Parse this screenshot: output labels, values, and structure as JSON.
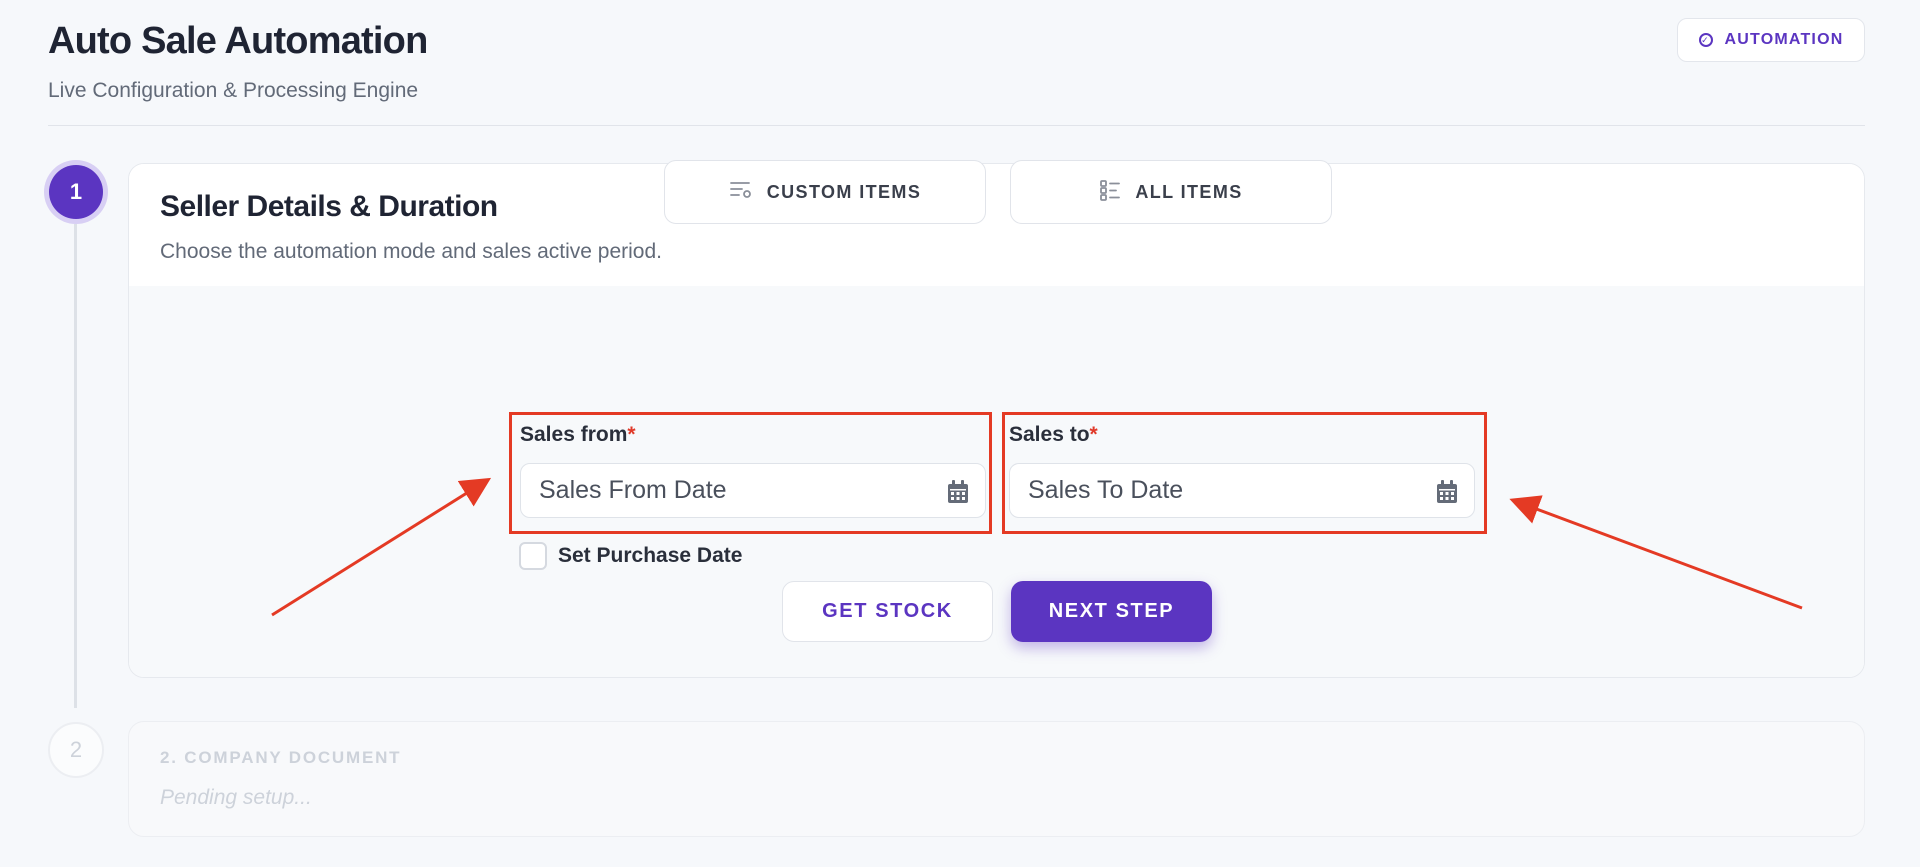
{
  "header": {
    "title": "Auto Sale Automation",
    "subtitle": "Live Configuration & Processing Engine",
    "badge_label": "AUTOMATION",
    "badge_icon": "check-circle-icon"
  },
  "steps": [
    {
      "number": "1",
      "state": "active",
      "title": "Seller Details & Duration",
      "description": "Choose the automation mode and sales active period."
    },
    {
      "number": "2",
      "state": "pending",
      "title": "2. COMPANY DOCUMENT",
      "status": "Pending setup..."
    }
  ],
  "mode_toggle": {
    "custom_items": {
      "label": "CUSTOM ITEMS",
      "icon": "list-settings-icon"
    },
    "all_items": {
      "label": "ALL ITEMS",
      "icon": "list-checks-icon"
    }
  },
  "form": {
    "sales_from": {
      "label": "Sales from",
      "required_marker": "*",
      "placeholder": "Sales From Date",
      "value": "",
      "icon": "calendar-icon"
    },
    "sales_to": {
      "label": "Sales to",
      "required_marker": "*",
      "placeholder": "Sales To Date",
      "value": "",
      "icon": "calendar-icon"
    },
    "set_purchase_date": {
      "label": "Set Purchase Date",
      "checked": false
    }
  },
  "actions": {
    "get_stock": "GET STOCK",
    "next_step": "NEXT STEP"
  },
  "colors": {
    "accent": "#5b35c1",
    "annotation": "#e43a24",
    "required": "#e03a2a"
  }
}
